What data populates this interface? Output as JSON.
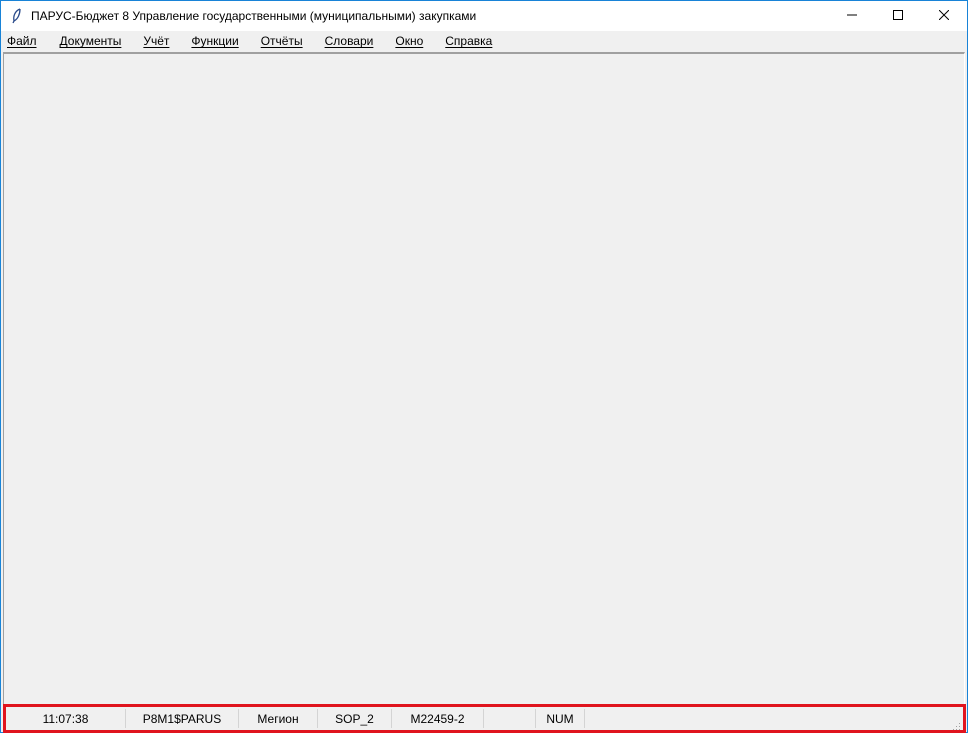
{
  "window": {
    "title": "ПАРУС-Бюджет 8 Управление государственными (муниципальными) закупками",
    "icons": {
      "app": "feather-icon",
      "minimize": "minimize-icon",
      "maximize": "maximize-icon",
      "close": "close-icon"
    }
  },
  "menu": {
    "items": [
      {
        "label": "Файл"
      },
      {
        "label": "Документы"
      },
      {
        "label": "Учёт"
      },
      {
        "label": "Функции"
      },
      {
        "label": "Отчёты"
      },
      {
        "label": "Словари"
      },
      {
        "label": "Окно"
      },
      {
        "label": "Справка"
      }
    ]
  },
  "statusbar": {
    "cells": [
      {
        "text": "11:07:38"
      },
      {
        "text": "P8M1$PARUS"
      },
      {
        "text": "Мегион"
      },
      {
        "text": "SOP_2"
      },
      {
        "text": "M22459-2"
      },
      {
        "text": ""
      },
      {
        "text": "NUM"
      },
      {
        "text": ""
      }
    ]
  },
  "colors": {
    "window_border": "#1883d7",
    "highlight": "#e0141e",
    "background": "#f0f0f0"
  }
}
